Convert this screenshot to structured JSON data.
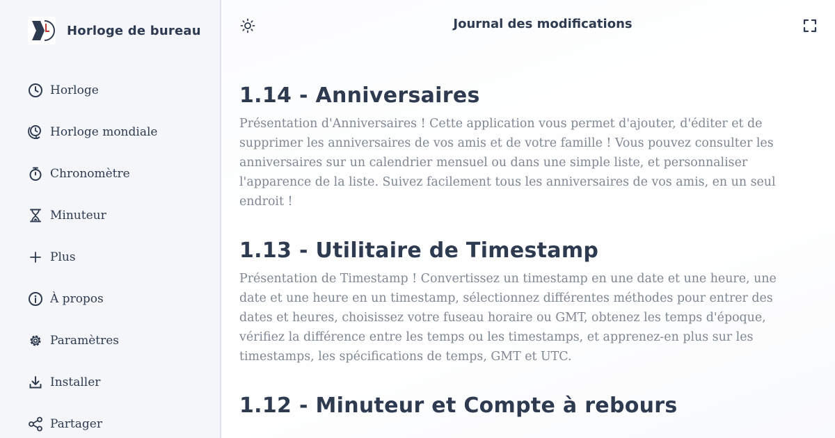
{
  "app": {
    "name": "Horloge de bureau",
    "logo_icon": "clock-logo-icon"
  },
  "sidebar": {
    "items": [
      {
        "label": "Horloge",
        "icon": "clock-icon"
      },
      {
        "label": "Horloge mondiale",
        "icon": "world-clock-icon"
      },
      {
        "label": "Chronomètre",
        "icon": "stopwatch-icon"
      },
      {
        "label": "Minuteur",
        "icon": "hourglass-icon"
      },
      {
        "label": "Plus",
        "icon": "plus-icon"
      },
      {
        "label": "À propos",
        "icon": "info-icon"
      },
      {
        "label": "Paramètres",
        "icon": "gear-icon"
      },
      {
        "label": "Installer",
        "icon": "download-icon"
      },
      {
        "label": "Partager",
        "icon": "share-icon"
      }
    ]
  },
  "header": {
    "title": "Journal des modifications",
    "theme_icon": "sun-icon",
    "fullscreen_icon": "fullscreen-icon"
  },
  "changelog": [
    {
      "title": "1.14 - Anniversaires",
      "text": "Présentation d'Anniversaires ! Cette application vous permet d'ajouter, d'éditer et de supprimer les anniversaires de vos amis et de votre famille ! Vous pouvez consulter les anniversaires sur un calendrier mensuel ou dans une simple liste, et personnaliser l'apparence de la liste. Suivez facilement tous les anniversaires de vos amis, en un seul endroit !"
    },
    {
      "title": "1.13 - Utilitaire de Timestamp",
      "text": "Présentation de Timestamp ! Convertissez un timestamp en une date et une heure, une date et une heure en un timestamp, sélectionnez différentes méthodes pour entrer des dates et heures, choisissez votre fuseau horaire ou GMT, obtenez les temps d'époque, vérifiez la différence entre les temps ou les timestamps, et apprenez-en plus sur les timestamps, les spécifications de temps, GMT et UTC."
    },
    {
      "title": "1.12 - Minuteur et Compte à rebours",
      "text": ""
    }
  ],
  "colors": {
    "text_dark": "#2d3a4f",
    "text_muted": "#7e8793",
    "sidebar_bg": "#f4f6f9",
    "logo_accent": "#c0392b"
  }
}
